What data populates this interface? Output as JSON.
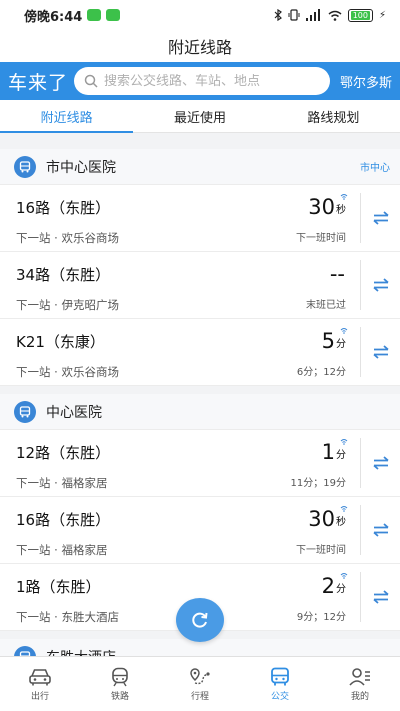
{
  "status": {
    "time": "傍晚6:44",
    "battery": "100"
  },
  "title": "附近线路",
  "search": {
    "brand": "车来了",
    "placeholder": "搜索公交线路、车站、地点",
    "city": "鄂尔多斯"
  },
  "tabs": [
    {
      "label": "附近线路",
      "active": true
    },
    {
      "label": "最近使用",
      "active": false
    },
    {
      "label": "路线规划",
      "active": false
    }
  ],
  "groups": [
    {
      "stop": "市中心医院",
      "district": "市中心",
      "routes": [
        {
          "name": "16路（东胜）",
          "next": "下一站 · 欢乐谷商场",
          "eta": "30",
          "unit": "秒",
          "sub": "下一班时间",
          "signal": true
        },
        {
          "name": "34路（东胜）",
          "next": "下一站 · 伊克昭广场",
          "eta": "--",
          "unit": "",
          "sub": "末班已过",
          "signal": false
        },
        {
          "name": "K21（东康）",
          "next": "下一站 · 欢乐谷商场",
          "eta": "5",
          "unit": "分",
          "sub": "6分；12分",
          "signal": true
        }
      ]
    },
    {
      "stop": "中心医院",
      "district": "",
      "routes": [
        {
          "name": "12路（东胜）",
          "next": "下一站 · 福格家居",
          "eta": "1",
          "unit": "分",
          "sub": "11分；19分",
          "signal": true
        },
        {
          "name": "16路（东胜）",
          "next": "下一站 · 福格家居",
          "eta": "30",
          "unit": "秒",
          "sub": "下一班时间",
          "signal": true
        },
        {
          "name": "1路（东胜）",
          "next": "下一站 · 东胜大酒店",
          "eta": "2",
          "unit": "分",
          "sub": "9分；12分",
          "signal": true
        }
      ]
    },
    {
      "stop": "东胜大酒店",
      "district": "",
      "routes": []
    }
  ],
  "nav": [
    {
      "label": "出行",
      "icon": "car-icon",
      "active": false
    },
    {
      "label": "铁路",
      "icon": "train-icon",
      "active": false
    },
    {
      "label": "行程",
      "icon": "route-icon",
      "active": false
    },
    {
      "label": "公交",
      "icon": "bus-icon",
      "active": true
    },
    {
      "label": "我的",
      "icon": "profile-icon",
      "active": false
    }
  ],
  "colors": {
    "accent": "#2f8ee3",
    "stop_icon": "#3a86d6",
    "refresh": "#4a9be5"
  }
}
